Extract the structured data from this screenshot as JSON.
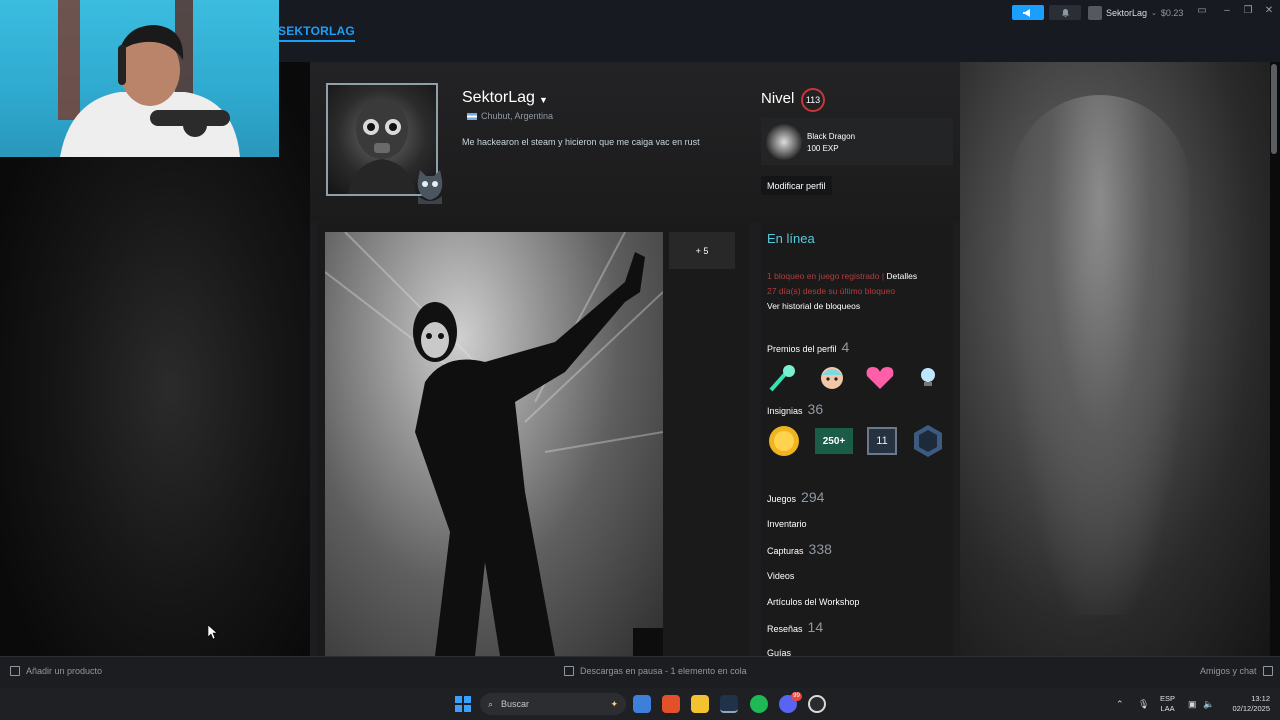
{
  "header": {
    "nav_title": "SEKTORLAG",
    "account_name": "SektorLag",
    "account_balance": "$0.23",
    "icons": [
      "megaphone-icon",
      "bell-icon",
      "monitor-icon",
      "minimize-icon",
      "maximize-icon",
      "close-icon"
    ]
  },
  "profile": {
    "name": "SektorLag",
    "location": "Chubut, Argentina",
    "summary": "Me hackearon el steam y hicieron que me caiga vac en rust",
    "level_label": "Nivel",
    "level": "113",
    "badge_name": "Black Dragon",
    "badge_exp": "100 EXP",
    "edit_button": "Modificar perfil"
  },
  "showcase": {
    "more_label": "+ 5"
  },
  "sidebar": {
    "status": "En línea",
    "ban_line1": "1 bloqueo en juego registrado | ",
    "ban_details": "Detalles",
    "ban_line2": "27 día(s) desde su último bloqueo",
    "ban_history": "Ver historial de bloqueos",
    "awards_label": "Premios del perfil",
    "awards_count": "4",
    "badges_label": "Insignias",
    "badges_count": "36",
    "badge_250": "250+",
    "badge_11": "11",
    "games_label": "Juegos",
    "games_count": "294",
    "inventory_label": "Inventario",
    "screenshots_label": "Capturas",
    "screenshots_count": "338",
    "videos_label": "Videos",
    "workshop_label": "Artículos del Workshop",
    "reviews_label": "Reseñas",
    "reviews_count": "14",
    "guides_label": "Guías"
  },
  "bottombar": {
    "add_product": "Añadir un producto",
    "downloads": "Descargas en pausa - 1 elemento en cola",
    "friends_chat": "Amigos y chat"
  },
  "taskbar": {
    "search_placeholder": "Buscar",
    "lang_line1": "ESP",
    "lang_line2": "LAA",
    "time": "13:12",
    "date": "02/12/2025",
    "notification_count": "99"
  },
  "colors": {
    "steam_blue": "#1a9fff",
    "online": "#57cbde",
    "ban_red": "#b43c3c",
    "level_ring": "#c9353b"
  }
}
